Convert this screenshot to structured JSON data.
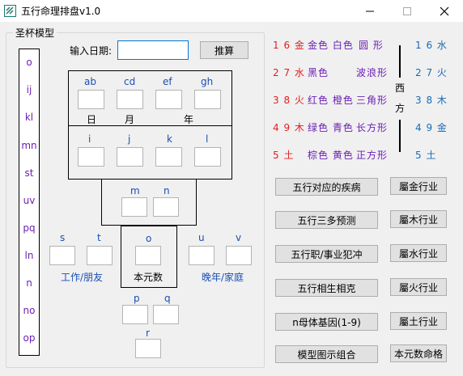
{
  "window": {
    "title": "五行命理排盘v1.0"
  },
  "group_title": "圣杯模型",
  "vertical_items": [
    "o",
    "ij",
    "kl",
    "mn",
    "st",
    "uv",
    "pq",
    "ln",
    "n",
    "no",
    "op"
  ],
  "date": {
    "label": "输入日期:",
    "value": "",
    "button": "推算"
  },
  "top_labels": [
    "ab",
    "cd",
    "ef",
    "gh"
  ],
  "dmy": [
    "日",
    "月",
    "年"
  ],
  "mid_labels": [
    "i",
    "j",
    "k",
    "l"
  ],
  "mn_labels": [
    "m",
    "n"
  ],
  "o_label": "o",
  "o_text": "本元数",
  "s_label": "s",
  "t_label": "t",
  "u_label": "u",
  "v_label": "v",
  "work_text": "工作/朋友",
  "late_text": "晚年/家庭",
  "p_label": "p",
  "q_label": "q",
  "r_label": "r",
  "legend": {
    "rows": [
      {
        "left": "1 6 金",
        "colors": "金色 白色",
        "shape": "圆  形",
        "right": "1 6 水"
      },
      {
        "left": "2 7 水",
        "colors": "黑色",
        "shape": "波浪形",
        "right": "2 7 火"
      },
      {
        "left": "3 8 火",
        "colors": "红色 橙色",
        "shape": "三角形",
        "right": "3 8 木"
      },
      {
        "left": "4 9 木",
        "colors": "绿色 青色",
        "shape": "长方形",
        "right": "4 9 金"
      },
      {
        "left": "5  土",
        "colors": "棕色 黄色",
        "shape": "正方形",
        "right": "5  土"
      }
    ],
    "west_1": "西",
    "west_2": "方"
  },
  "buttons": [
    {
      "left": "五行对应的疾病",
      "right": "屬金行业"
    },
    {
      "left": "五行三多预测",
      "right": "屬木行业"
    },
    {
      "left": "五行职/事业犯冲",
      "right": "屬水行业"
    },
    {
      "left": "五行相生相克",
      "right": "屬火行业"
    },
    {
      "left": "n母体基因(1-9)",
      "right": "屬土行业"
    },
    {
      "left": "模型图示组合",
      "right": "本元数命格"
    }
  ],
  "colors": {
    "red": "#e02020",
    "purple": "#6b1fb5",
    "blue": "#1a4fb3"
  }
}
